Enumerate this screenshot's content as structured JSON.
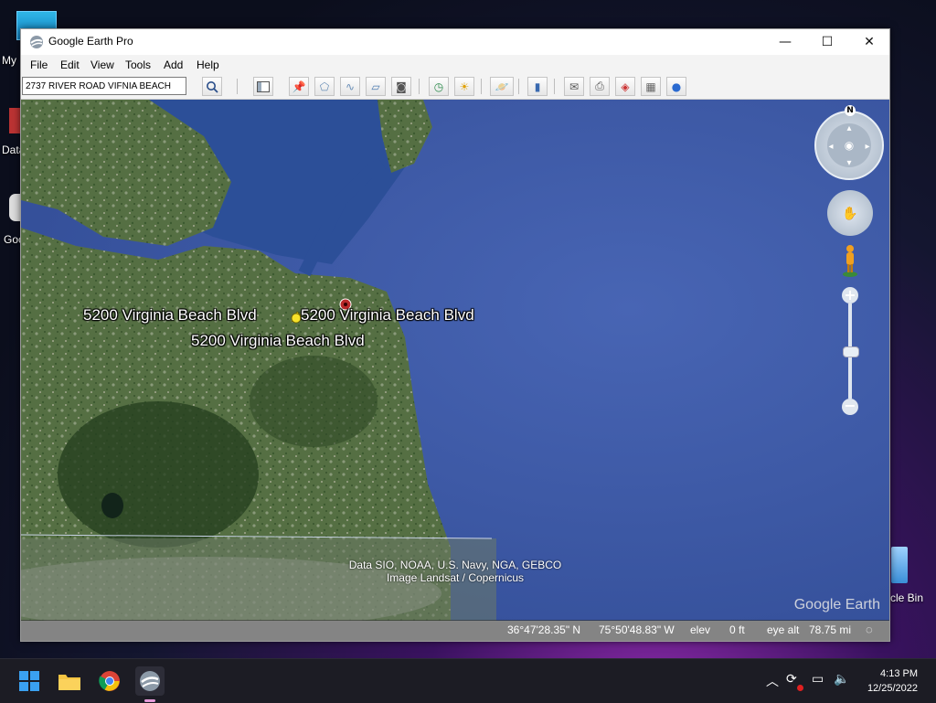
{
  "desktop": {
    "labels": [
      "My",
      "Data",
      "Goo",
      "cle Bin"
    ]
  },
  "window": {
    "title": "Google Earth Pro",
    "controls": {
      "minimize": "—",
      "maximize": "☐",
      "close": "✕"
    }
  },
  "menu": [
    "File",
    "Edit",
    "View",
    "Tools",
    "Add",
    "Help"
  ],
  "search": {
    "value": "2737 RIVER ROAD VIFNIA BEACH"
  },
  "map": {
    "place_labels": [
      "5200 Virginia Beach Blvd",
      "5200 Virginia Beach Blvd",
      "5200 Virginia Beach Blvd"
    ],
    "attribution_line1": "Data SIO, NOAA, U.S. Navy, NGA, GEBCO",
    "attribution_line2": "Image Landsat / Copernicus",
    "logo": "Google Earth",
    "compass_north": "N"
  },
  "status": {
    "lat": "36°47'28.35\" N",
    "lon": "75°50'48.83\" W",
    "elev_label": "elev",
    "elev_value": "0 ft",
    "eye_alt_label": "eye alt",
    "eye_alt_value": "78.75 mi"
  },
  "taskbar": {
    "time": "4:13 PM",
    "date": "12/25/2022"
  },
  "colors": {
    "ocean": "#3f58a4",
    "land": "#4e6a3c",
    "accent": "#0067c0"
  }
}
